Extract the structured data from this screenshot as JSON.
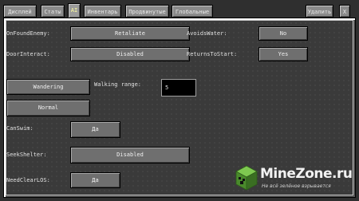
{
  "tabs": [
    {
      "label": "Дисплей"
    },
    {
      "label": "Статы"
    },
    {
      "label": "AI"
    },
    {
      "label": "Инвентарь"
    },
    {
      "label": "Продвинутые"
    },
    {
      "label": "Глобальные"
    }
  ],
  "top_right": {
    "delete_label": "Удалить",
    "close_label": "X"
  },
  "form": {
    "on_found_enemy": {
      "label": "OnFoundEnemy:",
      "value": "Retaliate"
    },
    "avoids_water": {
      "label": "AvoidsWater:",
      "value": "No"
    },
    "door_interact": {
      "label": "DoorInteract:",
      "value": "Disabled"
    },
    "returns_to_start": {
      "label": "ReturnsToStart:",
      "value": "Yes"
    },
    "movement_button": "Wandering",
    "walking_range": {
      "label": "Walking range:",
      "value": "5"
    },
    "animation_button": "Normal",
    "can_swim": {
      "label": "CanSwim:",
      "value": "Да"
    },
    "seek_shelter": {
      "label": "SeekShelter:",
      "value": "Disabled"
    },
    "need_clear_los": {
      "label": "NeedClearLOS:",
      "value": "Да"
    }
  },
  "watermark": {
    "title": "MineZone.ru",
    "subtitle": "Не всё зелёное взрывается"
  }
}
